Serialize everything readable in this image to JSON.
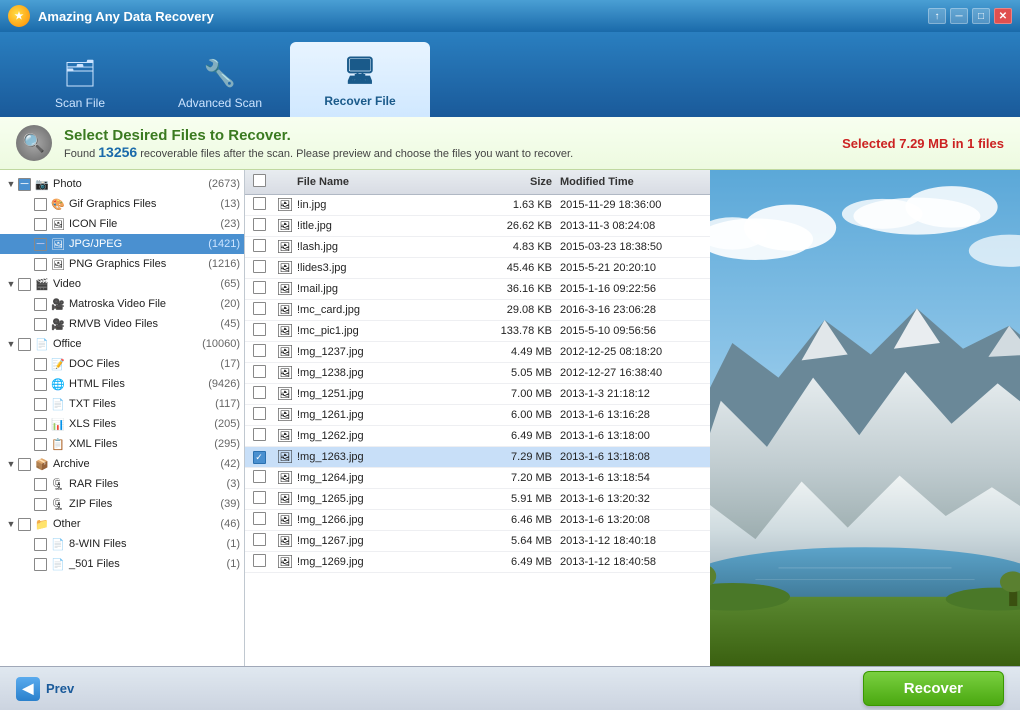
{
  "app": {
    "title": "Amazing Any Data Recovery",
    "logo": "★"
  },
  "titlebar": {
    "controls": [
      "↑",
      "─",
      "□",
      "✕"
    ]
  },
  "tabs": [
    {
      "id": "scan-file",
      "label": "Scan File",
      "icon": "🗂",
      "active": false
    },
    {
      "id": "advanced-scan",
      "label": "Advanced Scan",
      "icon": "🔧",
      "active": false
    },
    {
      "id": "recover-file",
      "label": "Recover File",
      "icon": "🖥",
      "active": true
    }
  ],
  "infobar": {
    "title": "Select Desired Files to Recover.",
    "subtitle_pre": "Found ",
    "count": "13256",
    "subtitle_post": " recoverable files after the scan. Please preview and choose the files you want to recover.",
    "selected_info": "Selected 7.29 MB in 1 files"
  },
  "tree": {
    "items": [
      {
        "id": "photo",
        "label": "Photo",
        "count": "(2673)",
        "level": 0,
        "expanded": true,
        "checked": "partial",
        "icon": "📷"
      },
      {
        "id": "gif",
        "label": "Gif Graphics Files",
        "count": "(13)",
        "level": 1,
        "checked": false,
        "icon": "🎨"
      },
      {
        "id": "icon",
        "label": "ICON File",
        "count": "(23)",
        "level": 1,
        "checked": false,
        "icon": "🖼"
      },
      {
        "id": "jpg",
        "label": "JPG/JPEG",
        "count": "(1421)",
        "level": 1,
        "checked": "partial",
        "icon": "🖼",
        "selected": true
      },
      {
        "id": "png",
        "label": "PNG Graphics Files",
        "count": "(1216)",
        "level": 1,
        "checked": false,
        "icon": "🖼"
      },
      {
        "id": "video",
        "label": "Video",
        "count": "(65)",
        "level": 0,
        "expanded": true,
        "checked": false,
        "icon": "🎬"
      },
      {
        "id": "matroska",
        "label": "Matroska Video File",
        "count": "(20)",
        "level": 1,
        "checked": false,
        "icon": "🎥"
      },
      {
        "id": "rmvb",
        "label": "RMVB Video Files",
        "count": "(45)",
        "level": 1,
        "checked": false,
        "icon": "🎥"
      },
      {
        "id": "office",
        "label": "Office",
        "count": "(10060)",
        "level": 0,
        "expanded": true,
        "checked": false,
        "icon": "📄"
      },
      {
        "id": "doc",
        "label": "DOC Files",
        "count": "(17)",
        "level": 1,
        "checked": false,
        "icon": "📝"
      },
      {
        "id": "html",
        "label": "HTML Files",
        "count": "(9426)",
        "level": 1,
        "checked": false,
        "icon": "🌐"
      },
      {
        "id": "txt",
        "label": "TXT Files",
        "count": "(117)",
        "level": 1,
        "checked": false,
        "icon": "📄"
      },
      {
        "id": "xls",
        "label": "XLS Files",
        "count": "(205)",
        "level": 1,
        "checked": false,
        "icon": "📊"
      },
      {
        "id": "xml",
        "label": "XML Files",
        "count": "(295)",
        "level": 1,
        "checked": false,
        "icon": "📋"
      },
      {
        "id": "archive",
        "label": "Archive",
        "count": "(42)",
        "level": 0,
        "expanded": true,
        "checked": false,
        "icon": "📦"
      },
      {
        "id": "rar",
        "label": "RAR Files",
        "count": "(3)",
        "level": 1,
        "checked": false,
        "icon": "🗜"
      },
      {
        "id": "zip",
        "label": "ZIP Files",
        "count": "(39)",
        "level": 1,
        "checked": false,
        "icon": "🗜"
      },
      {
        "id": "other",
        "label": "Other",
        "count": "(46)",
        "level": 0,
        "expanded": true,
        "checked": false,
        "icon": "📁"
      },
      {
        "id": "8win",
        "label": "8-WIN Files",
        "count": "(1)",
        "level": 1,
        "checked": false,
        "icon": "📄"
      },
      {
        "id": "501",
        "label": "_501 Files",
        "count": "(1)",
        "level": 1,
        "checked": false,
        "icon": "📄"
      }
    ]
  },
  "filetable": {
    "headers": [
      "File Name",
      "Size",
      "Modified Time"
    ],
    "rows": [
      {
        "id": 1,
        "name": "!in.jpg",
        "size": "1.63 KB",
        "time": "2015-11-29 18:36:00",
        "checked": false,
        "selected": false
      },
      {
        "id": 2,
        "name": "!itle.jpg",
        "size": "26.62 KB",
        "time": "2013-11-3 08:24:08",
        "checked": false,
        "selected": false
      },
      {
        "id": 3,
        "name": "!lash.jpg",
        "size": "4.83 KB",
        "time": "2015-03-23 18:38:50",
        "checked": false,
        "selected": false
      },
      {
        "id": 4,
        "name": "!lides3.jpg",
        "size": "45.46 KB",
        "time": "2015-5-21 20:20:10",
        "checked": false,
        "selected": false
      },
      {
        "id": 5,
        "name": "!mail.jpg",
        "size": "36.16 KB",
        "time": "2015-1-16 09:22:56",
        "checked": false,
        "selected": false
      },
      {
        "id": 6,
        "name": "!mc_card.jpg",
        "size": "29.08 KB",
        "time": "2016-3-16 23:06:28",
        "checked": false,
        "selected": false
      },
      {
        "id": 7,
        "name": "!mc_pic1.jpg",
        "size": "133.78 KB",
        "time": "2015-5-10 09:56:56",
        "checked": false,
        "selected": false
      },
      {
        "id": 8,
        "name": "!mg_1237.jpg",
        "size": "4.49 MB",
        "time": "2012-12-25 08:18:20",
        "checked": false,
        "selected": false
      },
      {
        "id": 9,
        "name": "!mg_1238.jpg",
        "size": "5.05 MB",
        "time": "2012-12-27 16:38:40",
        "checked": false,
        "selected": false
      },
      {
        "id": 10,
        "name": "!mg_1251.jpg",
        "size": "7.00 MB",
        "time": "2013-1-3 21:18:12",
        "checked": false,
        "selected": false
      },
      {
        "id": 11,
        "name": "!mg_1261.jpg",
        "size": "6.00 MB",
        "time": "2013-1-6 13:16:28",
        "checked": false,
        "selected": false
      },
      {
        "id": 12,
        "name": "!mg_1262.jpg",
        "size": "6.49 MB",
        "time": "2013-1-6 13:18:00",
        "checked": false,
        "selected": false
      },
      {
        "id": 13,
        "name": "!mg_1263.jpg",
        "size": "7.29 MB",
        "time": "2013-1-6 13:18:08",
        "checked": true,
        "selected": true
      },
      {
        "id": 14,
        "name": "!mg_1264.jpg",
        "size": "7.20 MB",
        "time": "2013-1-6 13:18:54",
        "checked": false,
        "selected": false
      },
      {
        "id": 15,
        "name": "!mg_1265.jpg",
        "size": "5.91 MB",
        "time": "2013-1-6 13:20:32",
        "checked": false,
        "selected": false
      },
      {
        "id": 16,
        "name": "!mg_1266.jpg",
        "size": "6.46 MB",
        "time": "2013-1-6 13:20:08",
        "checked": false,
        "selected": false
      },
      {
        "id": 17,
        "name": "!mg_1267.jpg",
        "size": "5.64 MB",
        "time": "2013-1-12 18:40:18",
        "checked": false,
        "selected": false
      },
      {
        "id": 18,
        "name": "!mg_1269.jpg",
        "size": "6.49 MB",
        "time": "2013-1-12 18:40:58",
        "checked": false,
        "selected": false
      }
    ]
  },
  "buttons": {
    "prev": "Prev",
    "recover": "Recover"
  }
}
